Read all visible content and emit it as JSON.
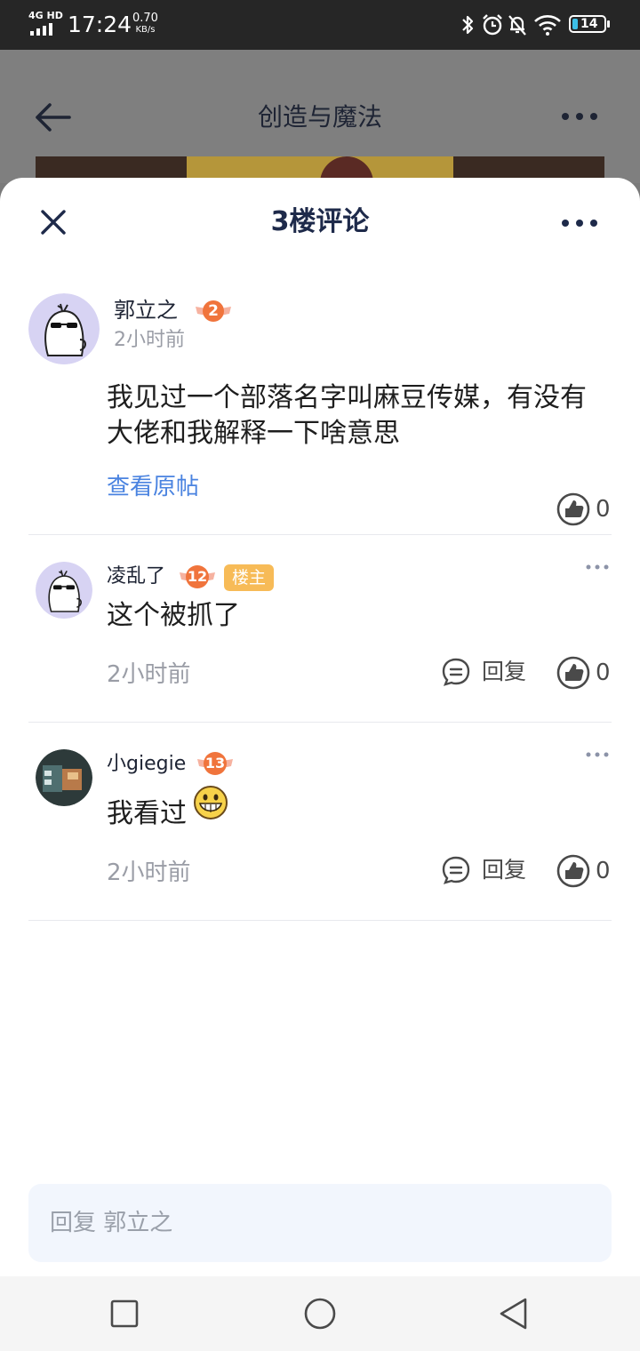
{
  "status_bar": {
    "network": "4G HD",
    "time": "17:24",
    "speed_value": "0.70",
    "speed_unit": "KB/s",
    "battery": "14",
    "icons": [
      "bluetooth-icon",
      "alarm-icon",
      "mute-icon",
      "wifi-icon",
      "battery-icon"
    ]
  },
  "background_page": {
    "title": "创造与魔法",
    "icons": [
      "back-arrow-icon",
      "more-icon"
    ]
  },
  "sheet": {
    "title": "3楼评论",
    "icons": [
      "close-icon",
      "more-icon"
    ]
  },
  "original_post": {
    "author": "郭立之",
    "level": "2",
    "time": "2小时前",
    "content": "我见过一个部落名字叫麻豆传媒，有没有大佬和我解释一下啥意思",
    "view_original_label": "查看原帖",
    "likes": "0"
  },
  "replies": [
    {
      "author": "凌乱了",
      "level": "12",
      "badge": "楼主",
      "content": "这个被抓了",
      "time": "2小时前",
      "reply_label": "回复",
      "likes": "0"
    },
    {
      "author": "小giegie",
      "level": "13",
      "content": "我看过",
      "emoji": "grinning-emoji",
      "time": "2小时前",
      "reply_label": "回复",
      "likes": "0"
    }
  ],
  "reply_input": {
    "placeholder": "回复 郭立之"
  },
  "nav_bar": {
    "icons": [
      "recents-icon",
      "home-icon",
      "back-icon"
    ]
  },
  "colors": {
    "accent_link": "#4a83e0",
    "owner_badge": "#f7bb57",
    "level_badge": "#f0743c",
    "title_text": "#1e2a4a"
  }
}
